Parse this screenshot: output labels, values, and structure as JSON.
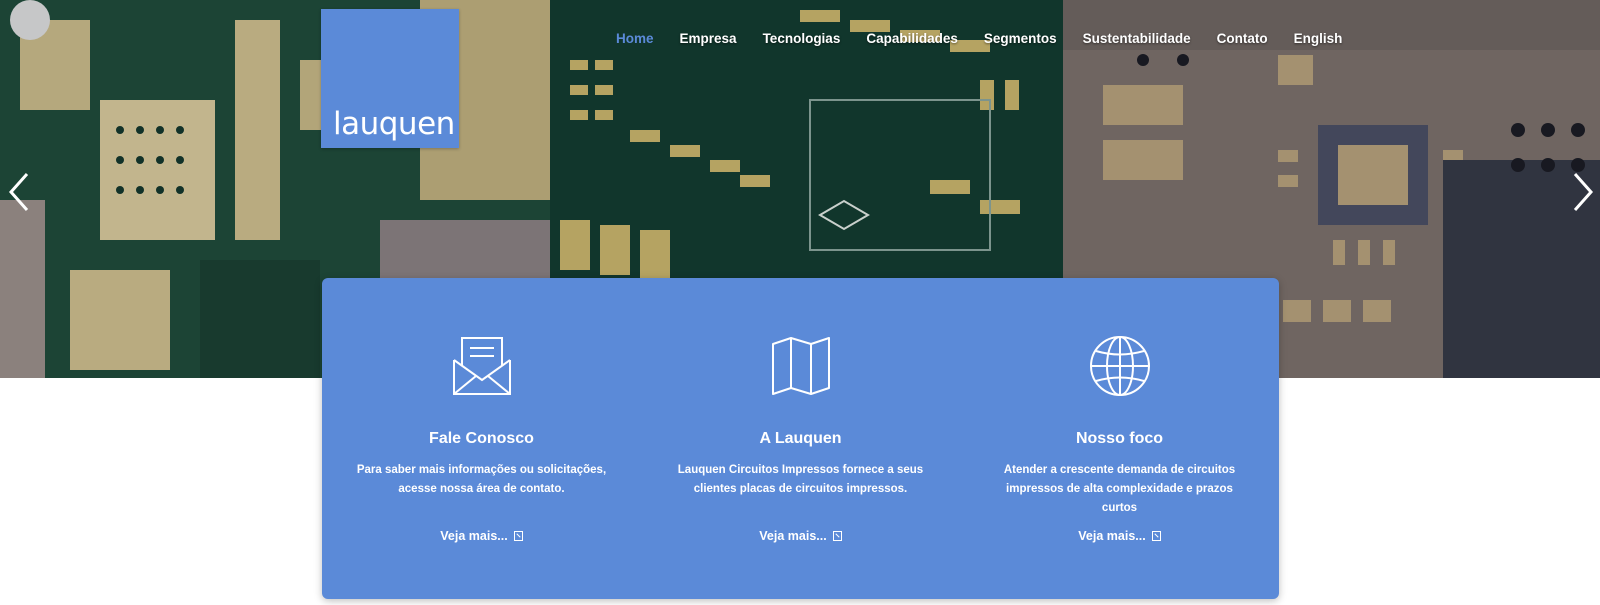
{
  "brand": {
    "logo_text": "lauquen",
    "accent_color": "#5b8ad8"
  },
  "nav": {
    "items": [
      {
        "label": "Home",
        "active": true
      },
      {
        "label": "Empresa",
        "active": false
      },
      {
        "label": "Tecnologias",
        "active": false
      },
      {
        "label": "Capabilidades",
        "active": false
      },
      {
        "label": "Segmentos",
        "active": false
      },
      {
        "label": "Sustentabilidade",
        "active": false
      },
      {
        "label": "Contato",
        "active": false
      },
      {
        "label": "English",
        "active": false
      }
    ]
  },
  "slider": {
    "prev_icon": "chevron-left-icon",
    "next_icon": "chevron-right-icon"
  },
  "features": [
    {
      "icon": "envelope-icon",
      "title": "Fale Conosco",
      "text": "Para saber mais informações ou solicitações, acesse nossa área de contato.",
      "link": "Veja mais..."
    },
    {
      "icon": "map-icon",
      "title": "A Lauquen",
      "text": "Lauquen Circuitos Impressos fornece a seus clientes placas de circuitos impressos.",
      "link": "Veja mais..."
    },
    {
      "icon": "globe-icon",
      "title": "Nosso foco",
      "text": "Atender a crescente demanda de circuitos impressos de alta complexidade e prazos curtos",
      "link": "Veja mais..."
    }
  ]
}
